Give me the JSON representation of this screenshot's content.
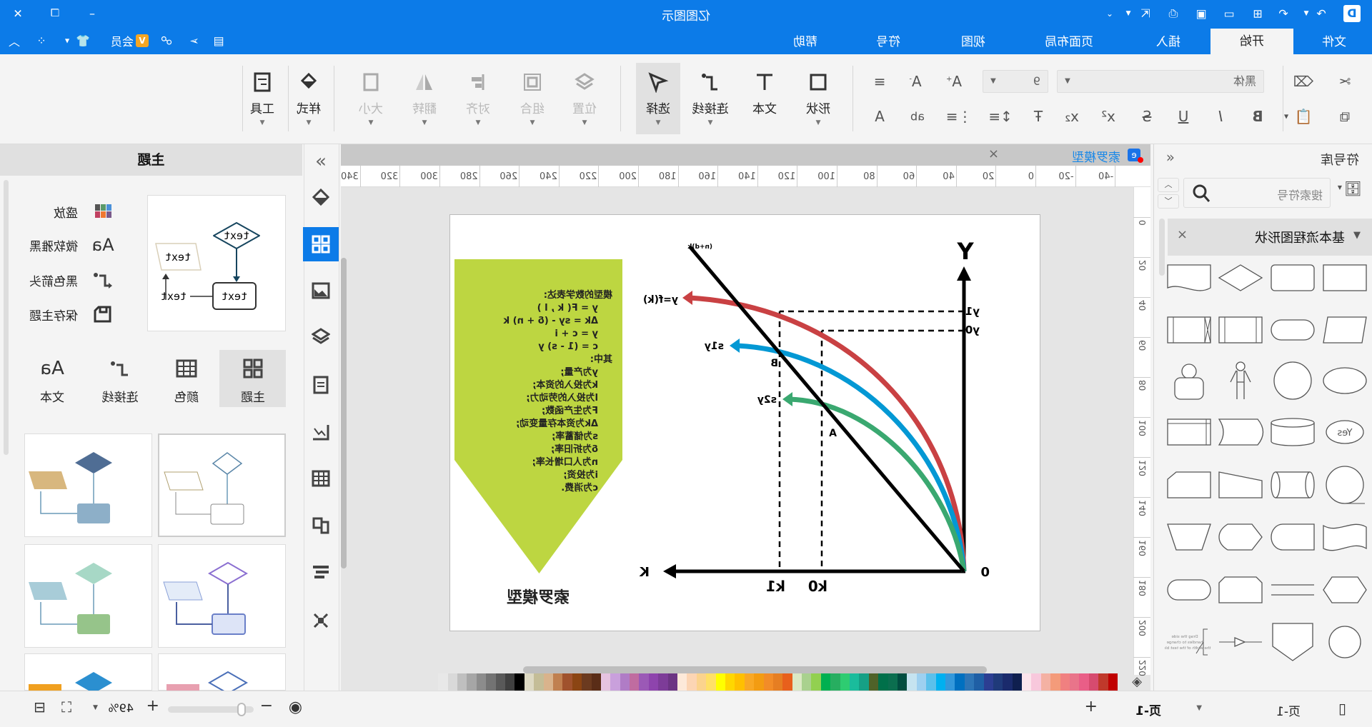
{
  "app": {
    "title": "亿图图示",
    "brand_color": "#0c7be8"
  },
  "titlebar": {
    "quick_icons": [
      "app-logo-icon",
      "redo-icon",
      "undo-icon",
      "new-icon",
      "open-icon",
      "save-icon",
      "print-icon",
      "export-icon",
      "more-icon"
    ],
    "window_icons": [
      "minimize-icon",
      "restore-icon",
      "close-icon"
    ]
  },
  "tabs": [
    {
      "label": "文件"
    },
    {
      "label": "开始",
      "active": true
    },
    {
      "label": "插入"
    },
    {
      "label": "页面布局"
    },
    {
      "label": "视图"
    },
    {
      "label": "符号"
    },
    {
      "label": "帮助"
    }
  ],
  "tabbar_right": {
    "member_label": "会员"
  },
  "ribbon": {
    "font_name": "黑体",
    "font_size": "9",
    "big_buttons": [
      {
        "label": "形状"
      },
      {
        "label": "文本"
      },
      {
        "label": "连接线"
      },
      {
        "label": "选择",
        "selected": true
      },
      {
        "label": "位置",
        "disabled": true
      },
      {
        "label": "组合",
        "disabled": true
      },
      {
        "label": "对齐",
        "disabled": true
      },
      {
        "label": "翻转",
        "disabled": true
      },
      {
        "label": "大小",
        "disabled": true
      },
      {
        "label": "样式"
      },
      {
        "label": "工具"
      }
    ]
  },
  "library": {
    "title": "符号库",
    "search_placeholder": "搜索符号",
    "category": "基本流程图形状",
    "yes_label": "Yes",
    "annotation_text": "Drag the side handles to change the width of the text block."
  },
  "document": {
    "tab_title": "索罗模型",
    "ruler_h": [
      "-40",
      "-20",
      "0",
      "20",
      "40",
      "60",
      "80",
      "100",
      "120",
      "140",
      "160",
      "180",
      "200",
      "220",
      "240",
      "260",
      "280",
      "300",
      "320",
      "340"
    ],
    "ruler_v": [
      "0",
      "20",
      "40",
      "60",
      "80",
      "100",
      "120",
      "140",
      "160",
      "180",
      "200",
      "220"
    ],
    "banner": {
      "color": "#bdd641",
      "title": "索罗模型",
      "lines": [
        {
          "t": "模型的数学表达:",
          "indent": false
        },
        {
          "t": "y = F( k , l )",
          "indent": true
        },
        {
          "t": "Δk = sy - (δ + n) k",
          "indent": true
        },
        {
          "t": "y = c + i",
          "indent": true
        },
        {
          "t": "c = (1 - s) y",
          "indent": true
        },
        {
          "t": "其中:",
          "indent": false
        },
        {
          "t": "y为产量;",
          "indent": true
        },
        {
          "t": "k为投入的资本;",
          "indent": true
        },
        {
          "t": "l为投入的劳动力;",
          "indent": true
        },
        {
          "t": "F为生产函数;",
          "indent": true
        },
        {
          "t": "Δk为资本存量变动;",
          "indent": true
        },
        {
          "t": "s为储蓄率;",
          "indent": true
        },
        {
          "t": "δ为折旧率;",
          "indent": true
        },
        {
          "t": "n为人口增长率;",
          "indent": true
        },
        {
          "t": "i为投资;",
          "indent": true
        },
        {
          "t": "c为消费.",
          "indent": true
        }
      ]
    },
    "diagram": {
      "y_axis": "Y",
      "x_axis": "K",
      "origin": "0",
      "line_label": "(n+d)k",
      "curve_f": "y=f(k)",
      "curve_s1": "s1y",
      "curve_s2": "s2y",
      "point_a": "A",
      "point_b": "B",
      "y1": "y1",
      "y0": "y0",
      "k1": "k1",
      "k0": "k0",
      "colors": {
        "f": "#c94143",
        "s1": "#0398d4",
        "s2": "#3aa870"
      }
    }
  },
  "palette": [
    "#e8e8e8",
    "#d9d9d9",
    "#bfbfbf",
    "#a6a6a6",
    "#8c8c8c",
    "#737373",
    "#595959",
    "#404040",
    "#000000",
    "#ddd9c3",
    "#c4bd97",
    "#d9b38c",
    "#c08050",
    "#a0522d",
    "#8b4513",
    "#6b3a1f",
    "#5a2d17",
    "#e6c3e0",
    "#c9a0dc",
    "#b07cc6",
    "#c06ca0",
    "#9b59b6",
    "#8e44ad",
    "#7d3c98",
    "#6c3483",
    "#fde9d9",
    "#fcd5b4",
    "#fbd38d",
    "#ffe066",
    "#ffff00",
    "#ffd700",
    "#ffc000",
    "#f9a825",
    "#f39c12",
    "#f28c28",
    "#e67e22",
    "#e8601c",
    "#dbe9c4",
    "#a9d18e",
    "#92d050",
    "#00b050",
    "#27ae60",
    "#2ecc71",
    "#1abc9c",
    "#16a085",
    "#4f6228",
    "#00704a",
    "#0b6e4f",
    "#004d40",
    "#c5e3f0",
    "#9dd0f0",
    "#5bc0eb",
    "#00b0f0",
    "#3498db",
    "#0070c0",
    "#2e75b6",
    "#1f5fa5",
    "#2c3e92",
    "#1f3a7a",
    "#1a2a6c",
    "#0f1f4f",
    "#fce4ec",
    "#f8c8dc",
    "#f4b1a3",
    "#f49b7a",
    "#f08080",
    "#e9748a",
    "#e95e87",
    "#d64b6f",
    "#c0392b",
    "#c00000"
  ],
  "theme_panel": {
    "title": "主题",
    "options": [
      {
        "label": "盛放",
        "icon": "palette-icon"
      },
      {
        "label": "微软雅黑",
        "icon": "font-icon"
      },
      {
        "label": "黑色箭头",
        "icon": "connector-icon"
      },
      {
        "label": "保存主题",
        "icon": "save-icon"
      }
    ],
    "preview_text": "text",
    "categories": [
      {
        "label": "主题",
        "active": true
      },
      {
        "label": "颜色"
      },
      {
        "label": "连接线"
      },
      {
        "label": "文本"
      }
    ]
  },
  "statusbar": {
    "page_label": "页-1",
    "page_tab": "页-1",
    "zoom": "49%",
    "zoom_fraction": 0.1
  }
}
